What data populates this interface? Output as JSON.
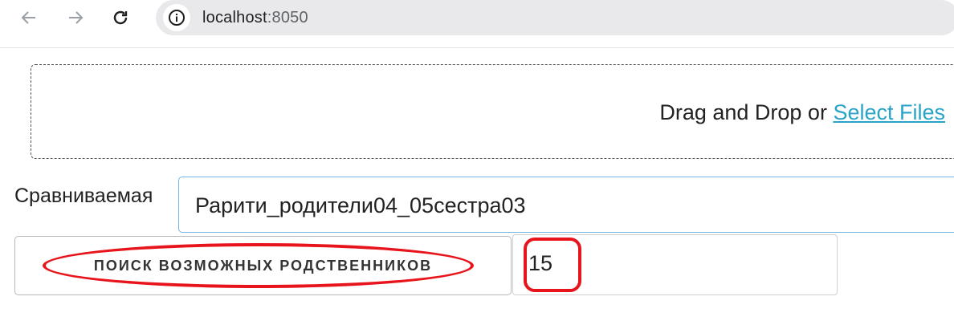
{
  "browser": {
    "url_host": "localhost",
    "url_port": ":8050",
    "icons": {
      "back": "arrow-left-icon",
      "forward": "arrow-right-icon",
      "reload": "reload-icon",
      "site_info": "info-circle-icon"
    }
  },
  "upload": {
    "prefix": "Drag and Drop or ",
    "link": "Select Files"
  },
  "compare": {
    "label": "Сравниваемая",
    "selected": "Рарити_родители04_05сестра03"
  },
  "search": {
    "button_label": "ПОИСК ВОЗМОЖНЫХ РОДСТВЕННИКОВ"
  },
  "count": {
    "value": "15"
  },
  "colors": {
    "annotation_red": "#e8141c",
    "link": "#2aa3c9",
    "dropdown_border": "#6fb7e3"
  }
}
